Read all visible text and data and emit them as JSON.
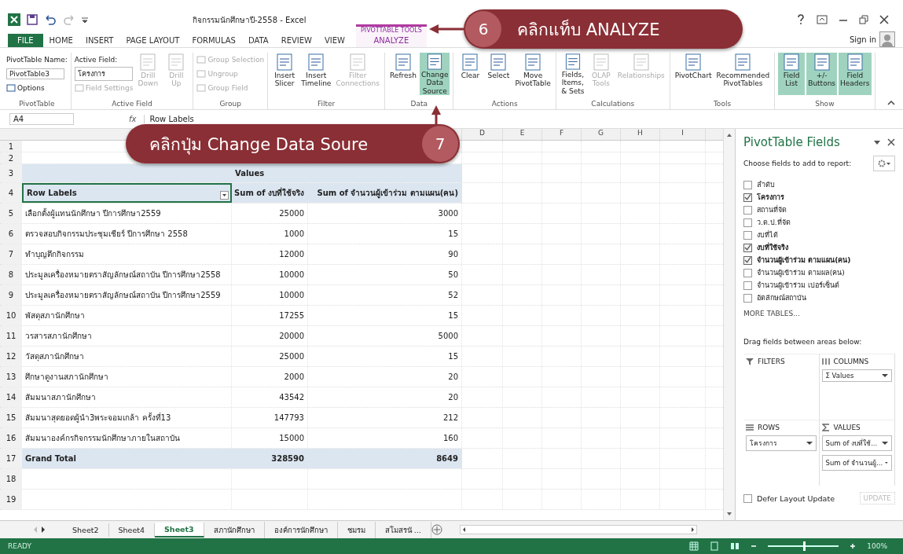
{
  "window": {
    "title": "กิจกรรมนักศึกษาปี-2558 - Excel",
    "sign_in": "Sign in"
  },
  "tabs": [
    {
      "label": "FILE",
      "kind": "file",
      "selected": false
    },
    {
      "label": "HOME",
      "kind": "plain",
      "selected": false
    },
    {
      "label": "INSERT",
      "kind": "plain",
      "selected": false
    },
    {
      "label": "PAGE LAYOUT",
      "kind": "plain",
      "selected": false
    },
    {
      "label": "FORMULAS",
      "kind": "plain",
      "selected": false
    },
    {
      "label": "DATA",
      "kind": "plain",
      "selected": false
    },
    {
      "label": "REVIEW",
      "kind": "plain",
      "selected": false
    },
    {
      "label": "VIEW",
      "kind": "plain",
      "selected": false
    },
    {
      "label": "ANALYZE",
      "kind": "contextual",
      "context": "PIVOTTABLE TOOLS",
      "selected": true
    }
  ],
  "ribbon": {
    "groups": [
      {
        "label": "PivotTable",
        "items": [
          {
            "kind": "label",
            "text": "PivotTable Name:"
          },
          {
            "kind": "field",
            "text": "PivotTable3"
          },
          {
            "kind": "small",
            "text": "Options",
            "disabled": false
          }
        ]
      },
      {
        "label": "Active Field",
        "items": [
          {
            "kind": "label",
            "text": "Active Field:"
          },
          {
            "kind": "field",
            "text": "โครงการ"
          },
          {
            "kind": "small",
            "text": "Field Settings",
            "disabled": true
          },
          {
            "kind": "large",
            "text": "Drill Down",
            "disabled": true
          },
          {
            "kind": "large",
            "text": "Drill Up",
            "disabled": true
          }
        ]
      },
      {
        "label": "Group",
        "items": [
          {
            "kind": "small",
            "text": "Group Selection",
            "disabled": true
          },
          {
            "kind": "small",
            "text": "Ungroup",
            "disabled": true
          },
          {
            "kind": "small",
            "text": "Group Field",
            "disabled": true
          }
        ]
      },
      {
        "label": "Filter",
        "items": [
          {
            "kind": "large",
            "text": "Insert Slicer",
            "disabled": false
          },
          {
            "kind": "large",
            "text": "Insert Timeline",
            "disabled": false
          },
          {
            "kind": "large",
            "text": "Filter Connections",
            "disabled": true
          }
        ]
      },
      {
        "label": "Data",
        "items": [
          {
            "kind": "large",
            "text": "Refresh",
            "disabled": false
          },
          {
            "kind": "large",
            "text": "Change Data Source",
            "disabled": false,
            "selected": true
          }
        ]
      },
      {
        "label": "Actions",
        "items": [
          {
            "kind": "large",
            "text": "Clear",
            "disabled": false
          },
          {
            "kind": "large",
            "text": "Select",
            "disabled": false
          },
          {
            "kind": "large",
            "text": "Move PivotTable",
            "disabled": false
          }
        ]
      },
      {
        "label": "Calculations",
        "items": [
          {
            "kind": "large",
            "text": "Fields, Items, & Sets",
            "disabled": false
          },
          {
            "kind": "large",
            "text": "OLAP Tools",
            "disabled": true
          },
          {
            "kind": "large",
            "text": "Relationships",
            "disabled": true
          }
        ]
      },
      {
        "label": "Tools",
        "items": [
          {
            "kind": "large",
            "text": "PivotChart",
            "disabled": false
          },
          {
            "kind": "large",
            "text": "Recommended PivotTables",
            "disabled": false
          }
        ]
      },
      {
        "label": "Show",
        "items": [
          {
            "kind": "large",
            "text": "Field List",
            "disabled": false,
            "selected": true
          },
          {
            "kind": "large",
            "text": "+/- Buttons",
            "disabled": false,
            "selected": true
          },
          {
            "kind": "large",
            "text": "Field Headers",
            "disabled": false,
            "selected": true
          }
        ]
      }
    ]
  },
  "formula_bar": {
    "name_box": "A4",
    "fx": "fx",
    "value": "Row Labels"
  },
  "sheet": {
    "column_letters": [
      "D",
      "E",
      "F",
      "G",
      "H",
      "I"
    ],
    "row_numbers": [
      "1",
      "2",
      "3",
      "4",
      "5",
      "6",
      "7",
      "8",
      "9",
      "10",
      "11",
      "12",
      "13",
      "14",
      "15",
      "16",
      "17",
      "18",
      "19"
    ],
    "values_caption": "Values",
    "header": [
      "Row Labels",
      "Sum of งบที่ใช้จริง",
      "Sum of จำนวนผู้เข้าร่วม ตามแผน(คน)"
    ],
    "rows": [
      [
        "เลือกตั้งผู้แทนนักศึกษา ปีการศึกษา2559",
        "25000",
        "3000"
      ],
      [
        "ตรวจสอบกิจกรรมประชุมเชียร์ ปีการศึกษา 2558",
        "1000",
        "15"
      ],
      [
        "ทำบุญตึกกิจกรรม",
        "12000",
        "90"
      ],
      [
        "ประมูลเครื่องหมายตราสัญลักษณ์สถาบัน ปีการศึกษา2558",
        "10000",
        "50"
      ],
      [
        "ประมูลเครื่องหมายตราสัญลักษณ์สถาบัน ปีการศึกษา2559",
        "10000",
        "52"
      ],
      [
        "พัสดุสภานักศึกษา",
        "17255",
        "15"
      ],
      [
        "วรสารสภานักศึกษา",
        "20000",
        "5000"
      ],
      [
        "วัสดุสภานักศึกษา",
        "25000",
        "15"
      ],
      [
        "ศึกษาดูงานสภานักศึกษา",
        "2000",
        "20"
      ],
      [
        "สัมมนาสภานักศึกษา",
        "43542",
        "20"
      ],
      [
        "สัมมนาสุดยอดผู้นำ3พระจอมเกล้า ครั้งที่13",
        "147793",
        "212"
      ],
      [
        "สัมมนาองค์กรกิจกรรมนักศึกษาภายในสถาบัน",
        "15000",
        "160"
      ]
    ],
    "total": [
      "Grand Total",
      "328590",
      "8649"
    ]
  },
  "sheet_tabs": [
    {
      "label": "Sheet2",
      "selected": false
    },
    {
      "label": "Sheet4",
      "selected": false
    },
    {
      "label": "Sheet3",
      "selected": true
    },
    {
      "label": "สภานักศึกษา",
      "selected": false
    },
    {
      "label": "องค์การนักศึกษา",
      "selected": false
    },
    {
      "label": "ชมรม",
      "selected": false
    },
    {
      "label": "สโมสรนั ...",
      "selected": false
    }
  ],
  "field_pane": {
    "title": "PivotTable Fields",
    "prompt": "Choose fields to add to report:",
    "fields": [
      {
        "label": "ลำดับ",
        "checked": false
      },
      {
        "label": "โครงการ",
        "checked": true
      },
      {
        "label": "สถานที่จัด",
        "checked": false
      },
      {
        "label": "ว.ด.ป.ที่จัด",
        "checked": false
      },
      {
        "label": "งบที่ได้",
        "checked": false
      },
      {
        "label": "งบที่ใช้จริง",
        "checked": true
      },
      {
        "label": "จำนวนผู้เข้าร่วม ตามแผน(คน)",
        "checked": true
      },
      {
        "label": "จำนวนผู้เข้าร่วม ตามผล(คน)",
        "checked": false
      },
      {
        "label": "จำนวนผู้เข้าร่วม เปอร์เซ็นต์",
        "checked": false
      },
      {
        "label": "อัตลักษณ์สถาบัน",
        "checked": false
      }
    ],
    "more_tables": "MORE TABLES...",
    "drag_hint": "Drag fields between areas below:",
    "areas": [
      {
        "kind": "filters",
        "title": "FILTERS"
      },
      {
        "kind": "columns",
        "title": "COLUMNS",
        "chips": [
          "Σ Values"
        ]
      },
      {
        "kind": "rows",
        "title": "ROWS",
        "chips": [
          "โครงการ"
        ]
      },
      {
        "kind": "values",
        "title": "VALUES",
        "chips": [
          "Sum of งบที่ใช้...",
          "Sum of จำนวนผู้..."
        ]
      }
    ],
    "defer": {
      "label": "Defer Layout Update",
      "checked": false
    },
    "update_button": {
      "label": "UPDATE",
      "disabled": true
    }
  },
  "status_bar": {
    "mode": "READY",
    "zoom": {
      "level": 0.5,
      "reading": "100%"
    }
  },
  "callouts": [
    {
      "number": "6",
      "text": "คลิกแท็บ ANALYZE"
    },
    {
      "number": "7",
      "text": "คลิกปุ่ม Change Data Soure"
    }
  ]
}
